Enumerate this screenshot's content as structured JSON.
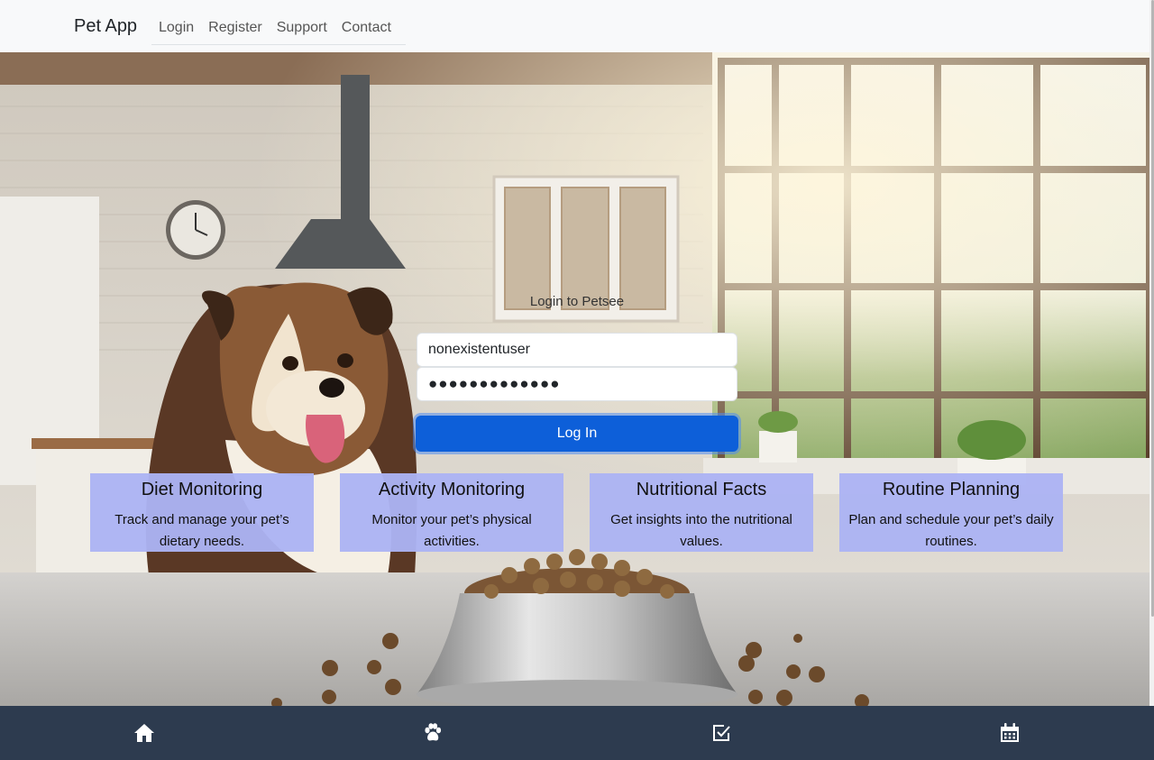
{
  "navbar": {
    "brand": "Pet App",
    "links": [
      "Login",
      "Register",
      "Support",
      "Contact"
    ]
  },
  "login": {
    "title": "Login to Petsee",
    "username_value": "nonexistentuser",
    "password_value": "●●●●●●●●●●●●●",
    "button_label": "Log In"
  },
  "features": [
    {
      "title": "Diet Monitoring",
      "desc": "Track and manage your pet’s dietary needs."
    },
    {
      "title": "Activity Monitoring",
      "desc": "Monitor your pet’s physical activities."
    },
    {
      "title": "Nutritional Facts",
      "desc": "Get insights into the nutritional values."
    },
    {
      "title": "Routine Planning",
      "desc": "Plan and schedule your pet’s daily routines."
    }
  ],
  "bottom_nav": {
    "icons": [
      "home-icon",
      "paw-icon",
      "checkbox-icon",
      "calendar-icon"
    ]
  },
  "colors": {
    "primary_button": "#0d5fd9",
    "card_bg": "#acb3f4",
    "bottom_nav_bg": "#2d3b4f"
  }
}
